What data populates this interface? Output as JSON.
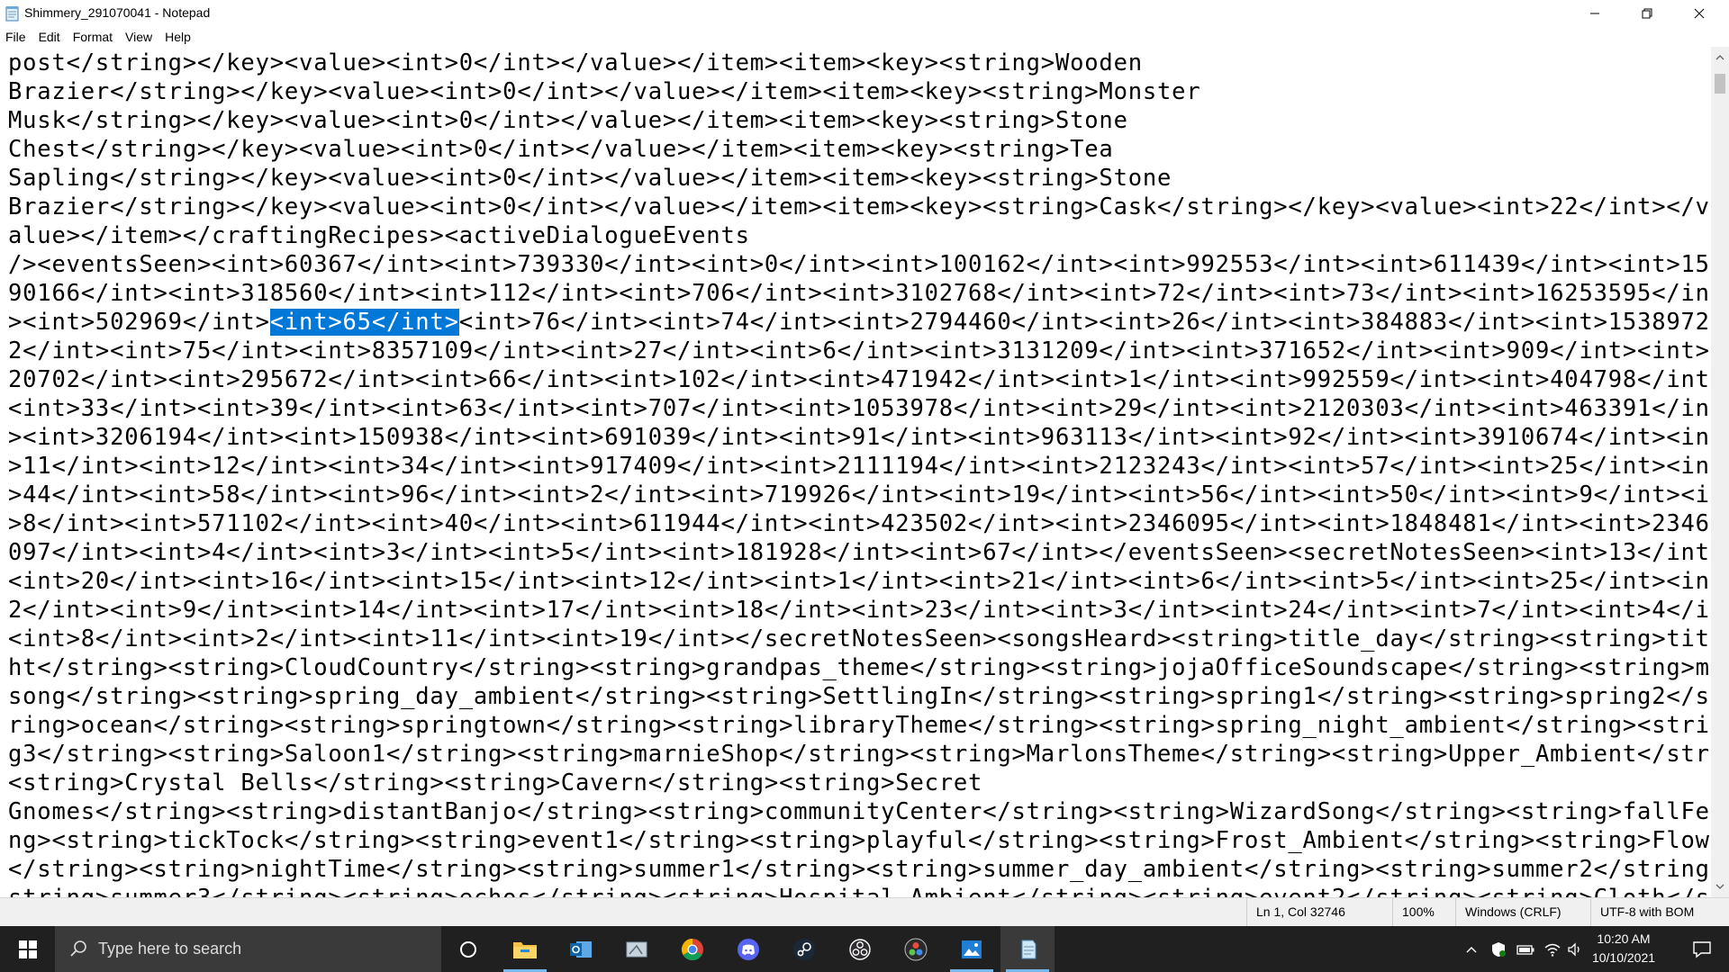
{
  "window": {
    "title": "Shimmery_291070041 - Notepad",
    "icon": "notepad-icon"
  },
  "menu": [
    {
      "label": "File"
    },
    {
      "label": "Edit"
    },
    {
      "label": "Format"
    },
    {
      "label": "View"
    },
    {
      "label": "Help"
    }
  ],
  "editor": {
    "lines": [
      {
        "t": "post</string></key><value><int>0</int></value></item><item><key><string>Wooden"
      },
      {
        "t": "Brazier</string></key><value><int>0</int></value></item><item><key><string>Monster"
      },
      {
        "t": "Musk</string></key><value><int>0</int></value></item><item><key><string>Stone"
      },
      {
        "t": "Chest</string></key><value><int>0</int></value></item><item><key><string>Tea"
      },
      {
        "t": "Sapling</string></key><value><int>0</int></value></item><item><key><string>Stone"
      },
      {
        "t": "Brazier</string></key><value><int>0</int></value></item><item><key><string>Cask</string></key><value><int>22</int></v"
      },
      {
        "t": "alue></item></craftingRecipes><activeDialogueEvents"
      },
      {
        "t": "/><eventsSeen><int>60367</int><int>739330</int><int>0</int><int>100162</int><int>992553</int><int>611439</int><int>15"
      },
      {
        "t": "90166</int><int>318560</int><int>112</int><int>706</int><int>3102768</int><int>72</int><int>73</int><int>16253595</int"
      },
      {
        "pre": "><int>502969</int>",
        "sel": "<int>65</int>",
        "post": "<int>76</int><int>74</int><int>2794460</int><int>26</int><int>384883</int><int>1538972"
      },
      {
        "t": "2</int><int>75</int><int>8357109</int><int>27</int><int>6</int><int>3131209</int><int>371652</int><int>909</int><int>5"
      },
      {
        "t": "20702</int><int>295672</int><int>66</int><int>102</int><int>471942</int><int>1</int><int>992559</int><int>404798</int>"
      },
      {
        "t": "<int>33</int><int>39</int><int>63</int><int>707</int><int>1053978</int><int>29</int><int>2120303</int><int>463391</int"
      },
      {
        "t": "><int>3206194</int><int>150938</int><int>691039</int><int>91</int><int>963113</int><int>92</int><int>3910674</int><int"
      },
      {
        "t": ">11</int><int>12</int><int>34</int><int>917409</int><int>2111194</int><int>2123243</int><int>57</int><int>25</int><int"
      },
      {
        "t": ">44</int><int>58</int><int>96</int><int>2</int><int>719926</int><int>19</int><int>56</int><int>50</int><int>9</int><int"
      },
      {
        "t": ">8</int><int>571102</int><int>40</int><int>611944</int><int>423502</int><int>2346095</int><int>1848481</int><int>2346"
      },
      {
        "t": "097</int><int>4</int><int>3</int><int>5</int><int>181928</int><int>67</int></eventsSeen><secretNotesSeen><int>13</int>"
      },
      {
        "t": "<int>20</int><int>16</int><int>15</int><int>12</int><int>1</int><int>21</int><int>6</int><int>5</int><int>25</int><int>2"
      },
      {
        "t": "2</int><int>9</int><int>14</int><int>17</int><int>18</int><int>23</int><int>3</int><int>24</int><int>7</int><int>4</int>"
      },
      {
        "t": "<int>8</int><int>2</int><int>11</int><int>19</int></secretNotesSeen><songsHeard><string>title_day</string><string>title_nig"
      },
      {
        "t": "ht</string><string>CloudCountry</string><string>grandpas_theme</string><string>jojaOfficeSoundscape</string><string>musicbox"
      },
      {
        "t": "song</string><string>spring_day_ambient</string><string>SettlingIn</string><string>spring1</string><string>spring2</string><st"
      },
      {
        "t": "ring>ocean</string><string>springtown</string><string>libraryTheme</string><string>spring_night_ambient</string><string>sprin"
      },
      {
        "t": "g3</string><string>Saloon1</string><string>marnieShop</string><string>MarlonsTheme</string><string>Upper_Ambient</string>"
      },
      {
        "t": "<string>Crystal Bells</string><string>Cavern</string><string>Secret"
      },
      {
        "t": "Gnomes</string><string>distantBanjo</string><string>communityCenter</string><string>WizardSong</string><string>fallFest</stri"
      },
      {
        "t": "ng><string>tickTock</string><string>event1</string><string>playful</string><string>Frost_Ambient</string><string>FlowerDance"
      },
      {
        "t": "</string><string>nightTime</string><string>summer1</string><string>summer_day_ambient</string><string>summer2</string><"
      },
      {
        "t": "string>summer3</string><string>echos</string><string>Hospital_Ambient</string><string>event2</string><string>Cloth</string>"
      }
    ]
  },
  "status": {
    "position": "Ln 1, Col 32746",
    "zoom": "100%",
    "line_ending": "Windows (CRLF)",
    "encoding": "UTF-8 with BOM"
  },
  "taskbar": {
    "search_placeholder": "Type here to search",
    "apps": [
      {
        "name": "task-view-icon"
      },
      {
        "name": "file-explorer-icon"
      },
      {
        "name": "outlook-icon"
      },
      {
        "name": "snipping-tool-icon"
      },
      {
        "name": "chrome-icon"
      },
      {
        "name": "discord-icon"
      },
      {
        "name": "steam-icon"
      },
      {
        "name": "obs-icon"
      },
      {
        "name": "davinci-resolve-icon"
      },
      {
        "name": "photos-icon"
      },
      {
        "name": "notepad-icon"
      }
    ],
    "clock": {
      "time": "10:20 AM",
      "date": "10/10/2021"
    }
  },
  "colors": {
    "selection": "#0078d7",
    "taskbar": "#202020",
    "accent": "#76b9ed"
  }
}
